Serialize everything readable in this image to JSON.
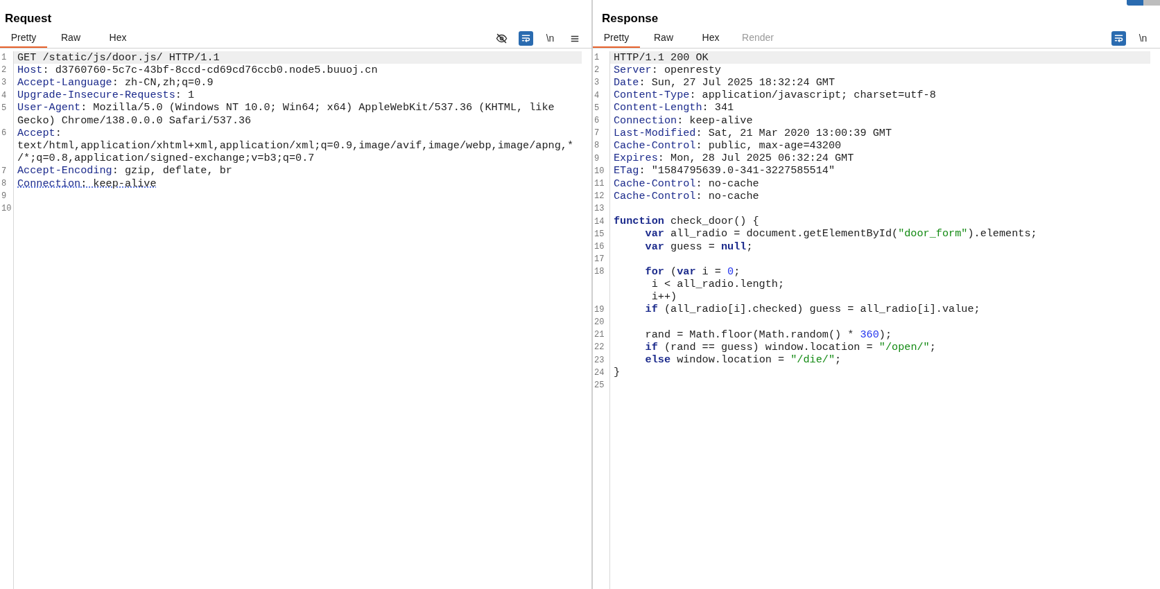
{
  "request": {
    "title": "Request",
    "tabs": [
      {
        "label": "Pretty",
        "selected": true,
        "disabled": false
      },
      {
        "label": "Raw",
        "selected": false,
        "disabled": false
      },
      {
        "label": "Hex",
        "selected": false,
        "disabled": false
      }
    ],
    "toolbar": [
      {
        "kind": "eye-off",
        "selected": false
      },
      {
        "kind": "wrap",
        "selected": true
      },
      {
        "kind": "newline",
        "text": "\\n",
        "selected": false
      },
      {
        "kind": "menu",
        "selected": false
      }
    ],
    "lines": [
      {
        "number": "1",
        "highlighted": true,
        "rows": [
          [
            {
              "kind": "text",
              "text": "GET /static/js/door.js/ HTTP/1.1"
            }
          ]
        ]
      },
      {
        "number": "2",
        "highlighted": false,
        "rows": [
          [
            {
              "kind": "name",
              "text": "Host"
            },
            {
              "kind": "text",
              "text": ": d3760760-5c7c-43bf-8ccd-cd69cd76ccb0.node5.buuoj.cn"
            }
          ]
        ]
      },
      {
        "number": "3",
        "highlighted": false,
        "rows": [
          [
            {
              "kind": "name",
              "text": "Accept-Language"
            },
            {
              "kind": "text",
              "text": ": zh-CN,zh;q=0.9"
            }
          ]
        ]
      },
      {
        "number": "4",
        "highlighted": false,
        "rows": [
          [
            {
              "kind": "name",
              "text": "Upgrade-Insecure-Requests"
            },
            {
              "kind": "text",
              "text": ": 1"
            }
          ]
        ]
      },
      {
        "number": "5",
        "highlighted": false,
        "underlined": false,
        "rows": [
          [
            {
              "kind": "name",
              "text": "User-Agent"
            },
            {
              "kind": "text",
              "text": ": Mozilla/5.0 (Windows NT 10.0; Win64; x64) AppleWebKit/537.36 (KHTML, like"
            }
          ],
          [
            {
              "kind": "text",
              "text": "Gecko) Chrome/138.0.0.0 Safari/537.36"
            }
          ]
        ]
      },
      {
        "number": "6",
        "highlighted": false,
        "rows": [
          [
            {
              "kind": "name",
              "text": "Accept"
            },
            {
              "kind": "text",
              "text": ":"
            }
          ],
          [
            {
              "kind": "text",
              "text": "text/html,application/xhtml+xml,application/xml;q=0.9,image/avif,image/webp,image/apng,*"
            }
          ],
          [
            {
              "kind": "text",
              "text": "/*;q=0.8,application/signed-exchange;v=b3;q=0.7"
            }
          ]
        ]
      },
      {
        "number": "7",
        "highlighted": false,
        "underlined": false,
        "rows": [
          [
            {
              "kind": "name",
              "text": "Accept-Encoding"
            },
            {
              "kind": "text",
              "text": ": gzip, deflate, br"
            }
          ]
        ]
      },
      {
        "number": "8",
        "highlighted": false,
        "underlined": true,
        "rows": [
          [
            {
              "kind": "name",
              "text": "Connection"
            },
            {
              "kind": "text",
              "text": ": keep-alive"
            }
          ]
        ]
      },
      {
        "number": "9",
        "highlighted": false,
        "rows": [
          []
        ]
      },
      {
        "number": "10",
        "highlighted": false,
        "rows": [
          []
        ]
      }
    ]
  },
  "response": {
    "title": "Response",
    "tabs": [
      {
        "label": "Pretty",
        "selected": true,
        "disabled": false
      },
      {
        "label": "Raw",
        "selected": false,
        "disabled": false
      },
      {
        "label": "Hex",
        "selected": false,
        "disabled": false
      },
      {
        "label": "Render",
        "selected": false,
        "disabled": true
      }
    ],
    "toolbar": [
      {
        "kind": "wrap",
        "selected": true
      },
      {
        "kind": "newline",
        "text": "\\n",
        "selected": false
      }
    ],
    "lines": [
      {
        "number": "1",
        "highlighted": true,
        "rows": [
          [
            {
              "kind": "text",
              "text": "HTTP/1.1 200 OK"
            }
          ]
        ]
      },
      {
        "number": "2",
        "highlighted": false,
        "rows": [
          [
            {
              "kind": "name",
              "text": "Server"
            },
            {
              "kind": "text",
              "text": ": openresty"
            }
          ]
        ]
      },
      {
        "number": "3",
        "highlighted": false,
        "rows": [
          [
            {
              "kind": "name",
              "text": "Date"
            },
            {
              "kind": "text",
              "text": ": Sun, 27 Jul 2025 18:32:24 GMT"
            }
          ]
        ]
      },
      {
        "number": "4",
        "highlighted": false,
        "rows": [
          [
            {
              "kind": "name",
              "text": "Content-Type"
            },
            {
              "kind": "text",
              "text": ": application/javascript; charset=utf-8"
            }
          ]
        ]
      },
      {
        "number": "5",
        "highlighted": false,
        "rows": [
          [
            {
              "kind": "name",
              "text": "Content-Length"
            },
            {
              "kind": "text",
              "text": ": 341"
            }
          ]
        ]
      },
      {
        "number": "6",
        "highlighted": false,
        "rows": [
          [
            {
              "kind": "name",
              "text": "Connection"
            },
            {
              "kind": "text",
              "text": ": keep-alive"
            }
          ]
        ]
      },
      {
        "number": "7",
        "highlighted": false,
        "rows": [
          [
            {
              "kind": "name",
              "text": "Last-Modified"
            },
            {
              "kind": "text",
              "text": ": Sat, 21 Mar 2020 13:00:39 GMT"
            }
          ]
        ]
      },
      {
        "number": "8",
        "highlighted": false,
        "rows": [
          [
            {
              "kind": "name",
              "text": "Cache-Control"
            },
            {
              "kind": "text",
              "text": ": public, max-age=43200"
            }
          ]
        ]
      },
      {
        "number": "9",
        "highlighted": false,
        "rows": [
          [
            {
              "kind": "name",
              "text": "Expires"
            },
            {
              "kind": "text",
              "text": ": Mon, 28 Jul 2025 06:32:24 GMT"
            }
          ]
        ]
      },
      {
        "number": "10",
        "highlighted": false,
        "rows": [
          [
            {
              "kind": "name",
              "text": "ETag"
            },
            {
              "kind": "text",
              "text": ": \"1584795639.0-341-3227585514\""
            }
          ]
        ]
      },
      {
        "number": "11",
        "highlighted": false,
        "rows": [
          [
            {
              "kind": "name",
              "text": "Cache-Control"
            },
            {
              "kind": "text",
              "text": ": no-cache"
            }
          ]
        ]
      },
      {
        "number": "12",
        "highlighted": false,
        "rows": [
          [
            {
              "kind": "name",
              "text": "Cache-Control"
            },
            {
              "kind": "text",
              "text": ": no-cache"
            }
          ]
        ]
      },
      {
        "number": "13",
        "highlighted": false,
        "rows": [
          []
        ]
      },
      {
        "number": "14",
        "highlighted": false,
        "rows": [
          [
            {
              "kind": "keyword",
              "text": "function"
            },
            {
              "kind": "text",
              "text": " check_door() {"
            }
          ]
        ]
      },
      {
        "number": "15",
        "highlighted": false,
        "rows": [
          [
            {
              "kind": "keyword",
              "text": "     var"
            },
            {
              "kind": "text",
              "text": " all_radio = document.getElementById("
            },
            {
              "kind": "string",
              "text": "\"door_form\""
            },
            {
              "kind": "text",
              "text": ").elements;"
            }
          ]
        ]
      },
      {
        "number": "16",
        "highlighted": false,
        "rows": [
          [
            {
              "kind": "keyword",
              "text": "     var"
            },
            {
              "kind": "text",
              "text": " guess = "
            },
            {
              "kind": "keyword",
              "text": "null"
            },
            {
              "kind": "text",
              "text": ";"
            }
          ]
        ]
      },
      {
        "number": "17",
        "highlighted": false,
        "rows": [
          []
        ]
      },
      {
        "number": "18",
        "highlighted": false,
        "rows": [
          [
            {
              "kind": "keyword",
              "text": "     for"
            },
            {
              "kind": "text",
              "text": " ("
            },
            {
              "kind": "keyword",
              "text": "var"
            },
            {
              "kind": "text",
              "text": " i = "
            },
            {
              "kind": "number",
              "text": "0"
            },
            {
              "kind": "text",
              "text": ";"
            }
          ],
          [
            {
              "kind": "text",
              "text": "      i < all_radio.length;"
            }
          ],
          [
            {
              "kind": "text",
              "text": "      i++)"
            }
          ]
        ]
      },
      {
        "number": "19",
        "highlighted": false,
        "rows": [
          [
            {
              "kind": "keyword",
              "text": "     if"
            },
            {
              "kind": "text",
              "text": " (all_radio[i].checked) guess = all_radio[i].value;"
            }
          ]
        ]
      },
      {
        "number": "20",
        "highlighted": false,
        "rows": [
          []
        ]
      },
      {
        "number": "21",
        "highlighted": false,
        "rows": [
          [
            {
              "kind": "text",
              "text": "     rand = Math.floor(Math.random() * "
            },
            {
              "kind": "number",
              "text": "360"
            },
            {
              "kind": "text",
              "text": ");"
            }
          ]
        ]
      },
      {
        "number": "22",
        "highlighted": false,
        "rows": [
          [
            {
              "kind": "keyword",
              "text": "     if"
            },
            {
              "kind": "text",
              "text": " (rand == guess) window.location = "
            },
            {
              "kind": "string",
              "text": "\"/open/\""
            },
            {
              "kind": "text",
              "text": ";"
            }
          ]
        ]
      },
      {
        "number": "23",
        "highlighted": false,
        "rows": [
          [
            {
              "kind": "keyword",
              "text": "     else"
            },
            {
              "kind": "text",
              "text": " window.location = "
            },
            {
              "kind": "string",
              "text": "\"/die/\""
            },
            {
              "kind": "text",
              "text": ";"
            }
          ]
        ]
      },
      {
        "number": "24",
        "highlighted": false,
        "rows": [
          [
            {
              "kind": "text",
              "text": "}"
            }
          ]
        ]
      },
      {
        "number": "25",
        "highlighted": false,
        "rows": [
          []
        ]
      }
    ]
  }
}
